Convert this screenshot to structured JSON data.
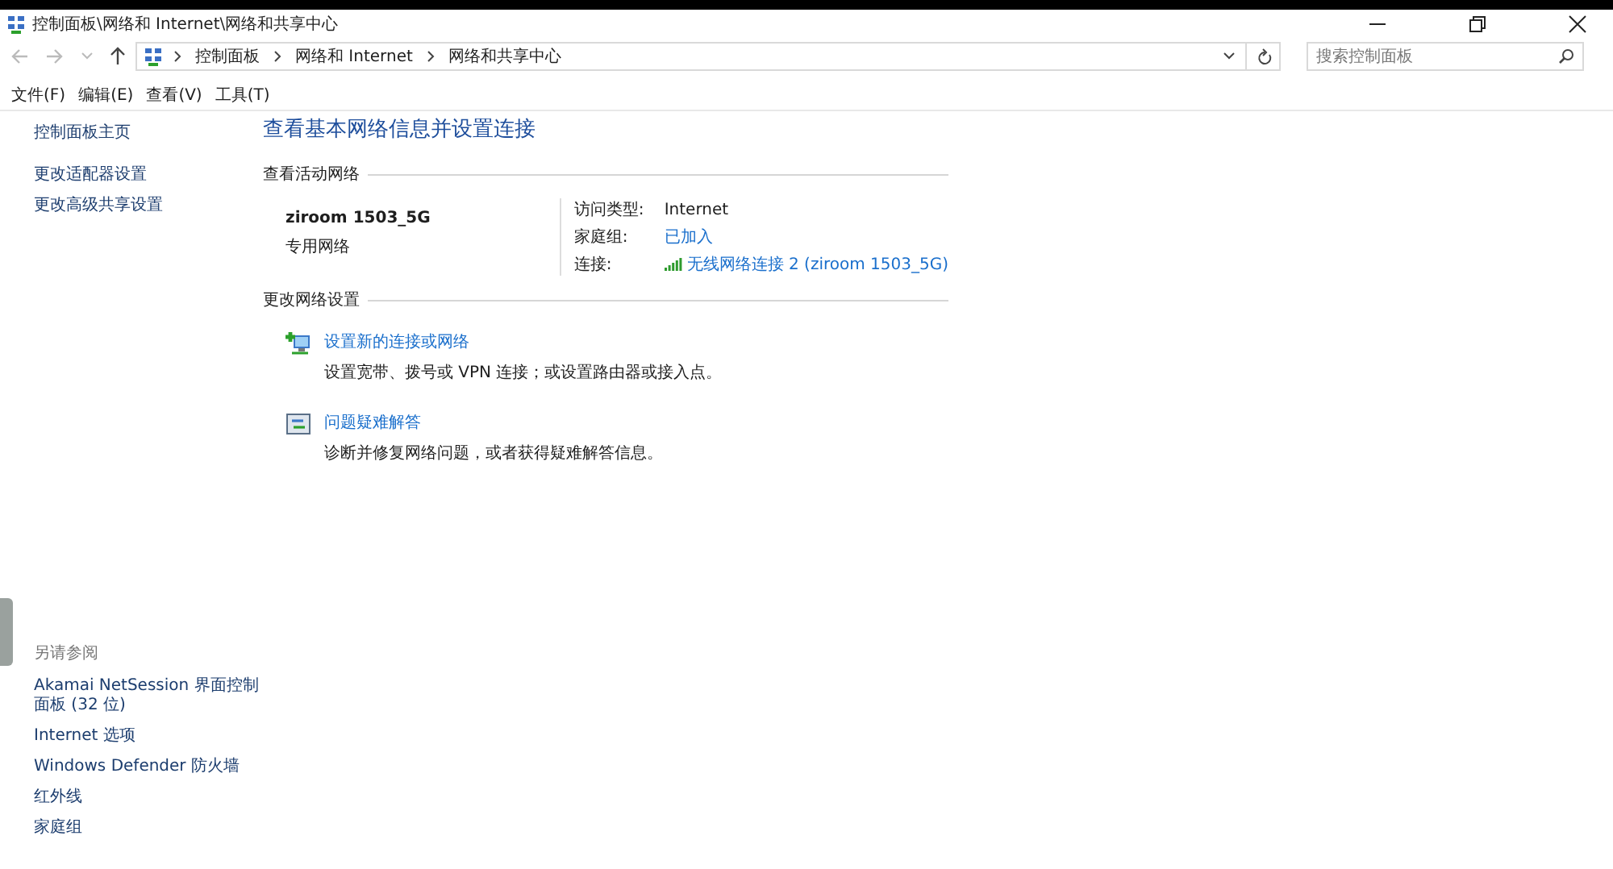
{
  "window": {
    "title": "控制面板\\网络和 Internet\\网络和共享中心"
  },
  "address_bar": {
    "crumbs": [
      "控制面板",
      "网络和 Internet",
      "网络和共享中心"
    ]
  },
  "search": {
    "placeholder": "搜索控制面板"
  },
  "menu": [
    "文件(F)",
    "编辑(E)",
    "查看(V)",
    "工具(T)"
  ],
  "sidebar": {
    "items": [
      "控制面板主页",
      "更改适配器设置",
      "更改高级共享设置"
    ],
    "see_also_title": "另请参阅",
    "see_also": [
      "Akamai NetSession 界面控制面板 (32 位)",
      "Internet 选项",
      "Windows Defender 防火墙",
      "红外线",
      "家庭组"
    ]
  },
  "main": {
    "heading": "查看基本网络信息并设置连接",
    "active_section": "查看活动网络",
    "network": {
      "name": "ziroom 1503_5G",
      "type": "专用网络"
    },
    "properties": [
      {
        "label": "访问类型:",
        "value": "Internet",
        "kind": "text"
      },
      {
        "label": "家庭组:",
        "value": "已加入",
        "kind": "link"
      },
      {
        "label": "连接:",
        "value": "无线网络连接 2 (ziroom 1503_5G)",
        "kind": "wifi-link"
      }
    ],
    "change_section": "更改网络设置",
    "tasks": [
      {
        "kind": "setup",
        "link": "设置新的连接或网络",
        "description": "设置宽带、拨号或 VPN 连接；或设置路由器或接入点。"
      },
      {
        "kind": "troubleshoot",
        "link": "问题疑难解答",
        "description": "诊断并修复网络问题，或者获得疑难解答信息。"
      }
    ]
  }
}
